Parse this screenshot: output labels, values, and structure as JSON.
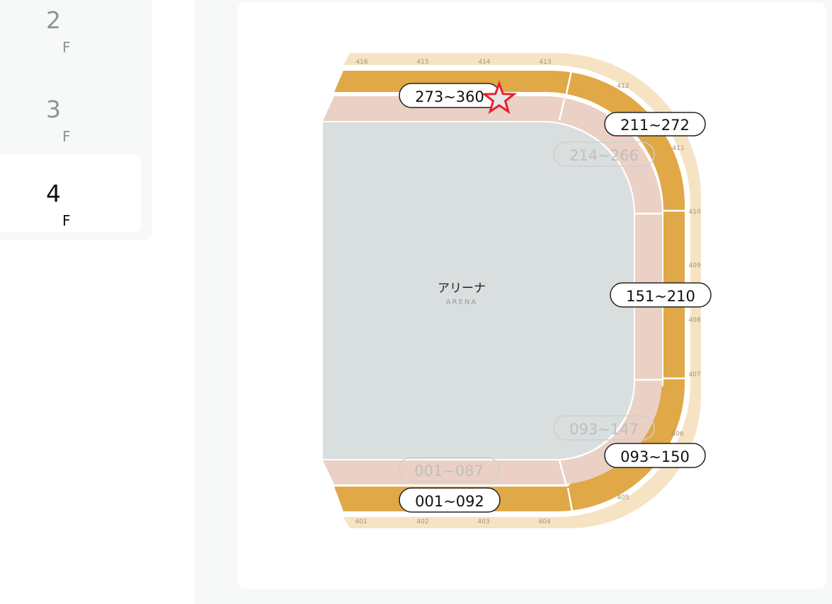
{
  "sidebar": {
    "floors": [
      {
        "num": "2",
        "suffix": "F",
        "active": false
      },
      {
        "num": "3",
        "suffix": "F",
        "active": false
      },
      {
        "num": "4",
        "suffix": "F",
        "active": true
      }
    ]
  },
  "map": {
    "arena_label_jp": "アリーナ",
    "arena_label_en": "ARENA",
    "outer_blocks": [
      "416",
      "415",
      "414",
      "413",
      "412",
      "411",
      "410",
      "409",
      "408",
      "407",
      "406",
      "405",
      "404",
      "403",
      "402",
      "401"
    ],
    "active_ranges": [
      "273~360",
      "211~272",
      "151~210",
      "093~150",
      "001~092"
    ],
    "inactive_ranges": [
      "214~266",
      "093~147",
      "001~087"
    ],
    "marker": "star-marker",
    "colors": {
      "outer_ring": "#f6e3c3",
      "gold_ring": "#e0a846",
      "inner_ring": "#ebd0c6",
      "arena": "#d9dedf",
      "marker": "#e8202a"
    }
  }
}
